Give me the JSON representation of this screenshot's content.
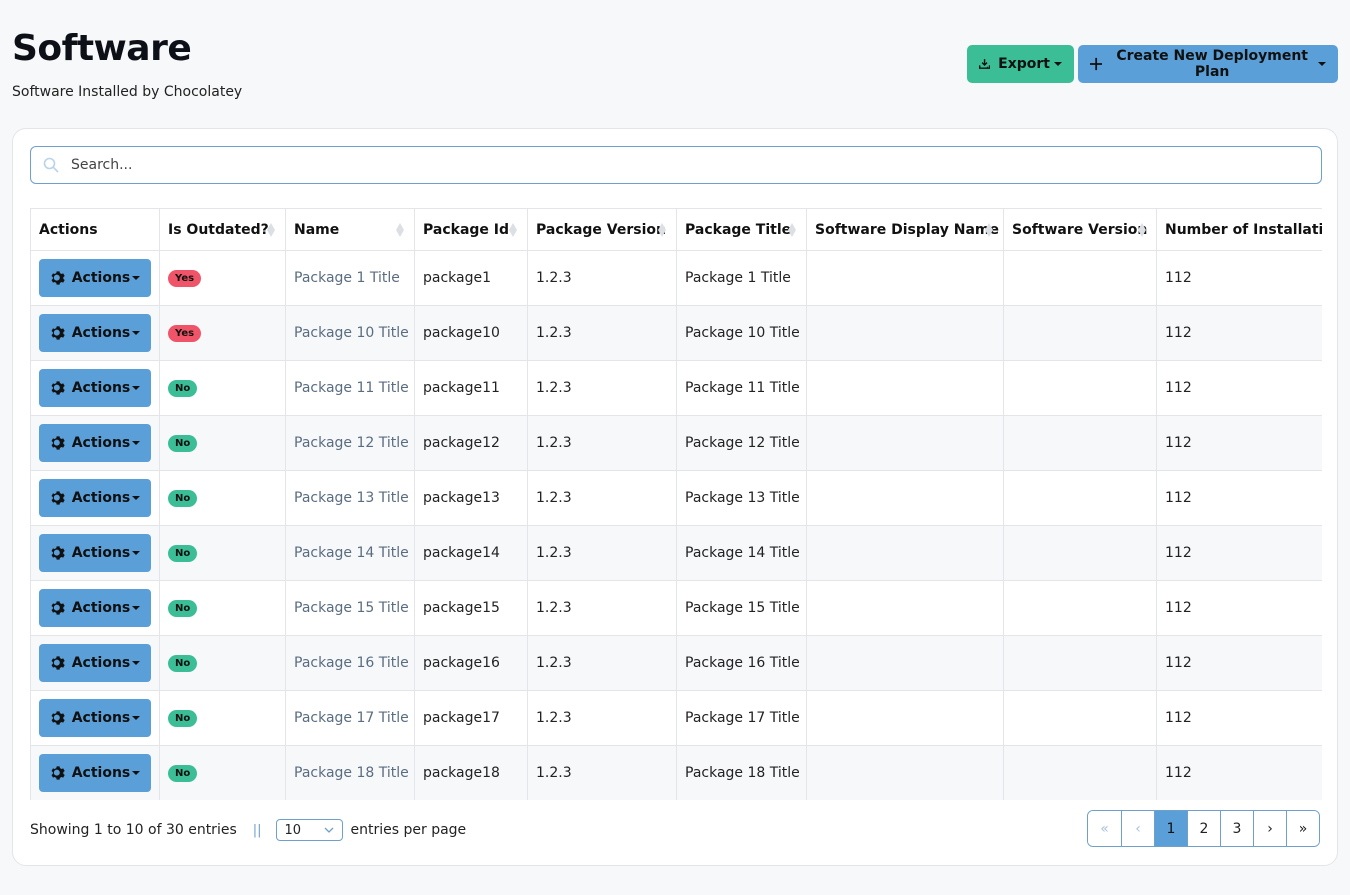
{
  "header": {
    "title": "Software",
    "subtitle": "Software Installed by Chocolatey",
    "export_label": "Export",
    "create_label": "Create New Deployment Plan"
  },
  "search": {
    "placeholder": "Search...",
    "value": ""
  },
  "table": {
    "columns": [
      "Actions",
      "Is Outdated?",
      "Name",
      "Package Id",
      "Package Version",
      "Package Title",
      "Software Display Name",
      "Software Version",
      "Number of Installations"
    ],
    "action_label": "Actions",
    "rows": [
      {
        "outdated": "Yes",
        "name": "Package 1 Title",
        "package_id": "package1",
        "version": "1.2.3",
        "title": "Package 1 Title",
        "display_name": "",
        "software_version": "",
        "installs": "112"
      },
      {
        "outdated": "Yes",
        "name": "Package 10 Title",
        "package_id": "package10",
        "version": "1.2.3",
        "title": "Package 10 Title",
        "display_name": "",
        "software_version": "",
        "installs": "112"
      },
      {
        "outdated": "No",
        "name": "Package 11 Title",
        "package_id": "package11",
        "version": "1.2.3",
        "title": "Package 11 Title",
        "display_name": "",
        "software_version": "",
        "installs": "112"
      },
      {
        "outdated": "No",
        "name": "Package 12 Title",
        "package_id": "package12",
        "version": "1.2.3",
        "title": "Package 12 Title",
        "display_name": "",
        "software_version": "",
        "installs": "112"
      },
      {
        "outdated": "No",
        "name": "Package 13 Title",
        "package_id": "package13",
        "version": "1.2.3",
        "title": "Package 13 Title",
        "display_name": "",
        "software_version": "",
        "installs": "112"
      },
      {
        "outdated": "No",
        "name": "Package 14 Title",
        "package_id": "package14",
        "version": "1.2.3",
        "title": "Package 14 Title",
        "display_name": "",
        "software_version": "",
        "installs": "112"
      },
      {
        "outdated": "No",
        "name": "Package 15 Title",
        "package_id": "package15",
        "version": "1.2.3",
        "title": "Package 15 Title",
        "display_name": "",
        "software_version": "",
        "installs": "112"
      },
      {
        "outdated": "No",
        "name": "Package 16 Title",
        "package_id": "package16",
        "version": "1.2.3",
        "title": "Package 16 Title",
        "display_name": "",
        "software_version": "",
        "installs": "112"
      },
      {
        "outdated": "No",
        "name": "Package 17 Title",
        "package_id": "package17",
        "version": "1.2.3",
        "title": "Package 17 Title",
        "display_name": "",
        "software_version": "",
        "installs": "112"
      },
      {
        "outdated": "No",
        "name": "Package 18 Title",
        "package_id": "package18",
        "version": "1.2.3",
        "title": "Package 18 Title",
        "display_name": "",
        "software_version": "",
        "installs": "112"
      }
    ]
  },
  "footer": {
    "showing": "Showing 1 to 10 of 30 entries",
    "separator": "||",
    "page_size": "10",
    "per_page_label": "entries per page"
  },
  "pagination": {
    "first": "«",
    "prev": "‹",
    "pages": [
      "1",
      "2",
      "3"
    ],
    "active": "1",
    "next": "›",
    "last": "»"
  },
  "colors": {
    "primary": "#5b9fd9",
    "success": "#3bbd95",
    "danger": "#ef5468"
  }
}
